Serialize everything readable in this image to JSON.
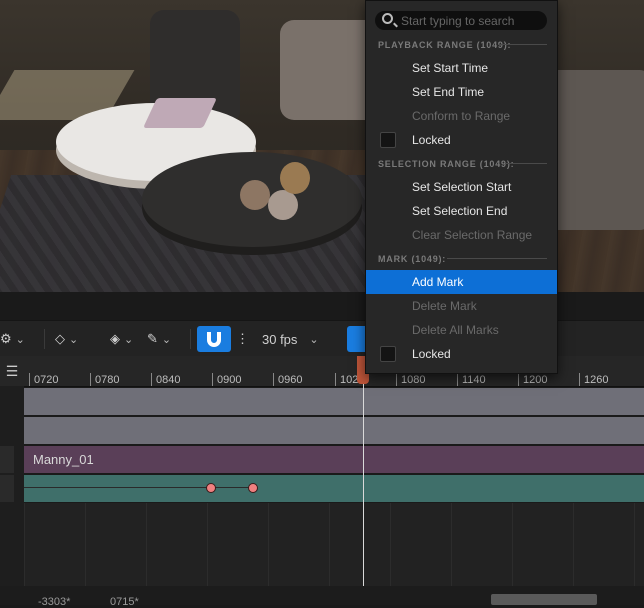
{
  "search": {
    "placeholder": "Start typing to search"
  },
  "menu": {
    "sections": [
      {
        "title": "PLAYBACK RANGE (1049):",
        "items": [
          {
            "label": "Set Start Time",
            "enabled": true
          },
          {
            "label": "Set End Time",
            "enabled": true
          },
          {
            "label": "Conform to Range",
            "enabled": false
          },
          {
            "label": "Locked",
            "checkbox": true,
            "checked": false
          }
        ]
      },
      {
        "title": "SELECTION RANGE (1049):",
        "items": [
          {
            "label": "Set Selection Start",
            "enabled": true
          },
          {
            "label": "Set Selection End",
            "enabled": true
          },
          {
            "label": "Clear Selection Range",
            "enabled": false
          }
        ]
      },
      {
        "title": "MARK (1049):",
        "items": [
          {
            "label": "Add Mark",
            "enabled": true,
            "highlighted": true
          },
          {
            "label": "Delete Mark",
            "enabled": false
          },
          {
            "label": "Delete All Marks",
            "enabled": false
          },
          {
            "label": "Locked",
            "checkbox": true,
            "checked": false
          }
        ]
      }
    ]
  },
  "toolbar": {
    "fps_label": "30 fps"
  },
  "ruler": {
    "ticks": [
      "0720",
      "0780",
      "0840",
      "0900",
      "0960",
      "102",
      "1080",
      "1140",
      "1200",
      "1260"
    ]
  },
  "tracks": {
    "manny_label": "Manny_01"
  },
  "bottom": {
    "left_value": "-3303*",
    "right_value": "0715*"
  },
  "colors": {
    "accent": "#0d6fd6",
    "playhead": "#c0563a",
    "key": "#f08080"
  }
}
